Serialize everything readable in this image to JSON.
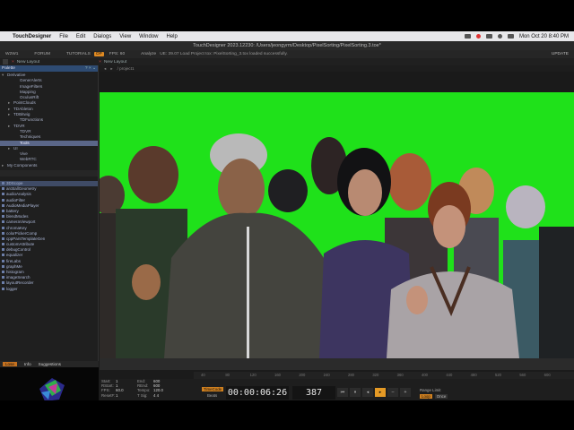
{
  "menubar": {
    "app_name": "TouchDesigner",
    "items": [
      "File",
      "Edit",
      "Dialogs",
      "View",
      "Window",
      "Help"
    ],
    "clock": "Mon Oct 20  8:40 PM"
  },
  "window": {
    "title": "TouchDesigner 2023.12230: /Users/jeongyrm/Desktop/PixelSorting/PixelSorting.3.toe*"
  },
  "toolbar": {
    "w1": "W2W1",
    "forum": "FORUM",
    "tutorials": "TUTORIALS",
    "op_badge": "OP",
    "fps": "FPS: 60",
    "analyze": "Analyze",
    "status": "UE: 39.07  Load Project   tox: PixelSorting_3.tox loaded successfully.",
    "update": "UPDATE"
  },
  "pane_tabs": {
    "left": "New Layout",
    "right": "New Layout"
  },
  "palette": {
    "header": "Palette",
    "tree": [
      {
        "label": "Derivative",
        "depth": 0,
        "tri": "▾"
      },
      {
        "label": "GenerAlerts",
        "depth": 2,
        "tri": ""
      },
      {
        "label": "ImageFilters",
        "depth": 2,
        "tri": ""
      },
      {
        "label": "Mapping",
        "depth": 2,
        "tri": ""
      },
      {
        "label": "OculusRift",
        "depth": 2,
        "tri": ""
      },
      {
        "label": "PointClouds",
        "depth": 1,
        "tri": "▸"
      },
      {
        "label": "TDAbleton",
        "depth": 1,
        "tri": "▸"
      },
      {
        "label": "TDBitwig",
        "depth": 1,
        "tri": "▸"
      },
      {
        "label": "TDFunctions",
        "depth": 2,
        "tri": ""
      },
      {
        "label": "TDVR",
        "depth": 1,
        "tri": "▸"
      },
      {
        "label": "TDVR",
        "depth": 2,
        "tri": ""
      },
      {
        "label": "Techniques",
        "depth": 2,
        "tri": ""
      },
      {
        "label": "Tools",
        "depth": 2,
        "tri": "",
        "selected": true
      },
      {
        "label": "UI",
        "depth": 1,
        "tri": "▸"
      },
      {
        "label": "Vive",
        "depth": 2,
        "tri": ""
      },
      {
        "label": "WebRTC",
        "depth": 2,
        "tri": ""
      },
      {
        "label": "My Components",
        "depth": 0,
        "tri": "▸"
      }
    ],
    "list": [
      {
        "label": "3DScope",
        "selected": true
      },
      {
        "label": "arcBallGeometry"
      },
      {
        "label": "audioAnalysis"
      },
      {
        "label": "audioFilter"
      },
      {
        "label": "AudioMediaPlayer"
      },
      {
        "label": "battery"
      },
      {
        "label": "blendModes"
      },
      {
        "label": "cameraViewport"
      },
      {
        "label": "chromaKey"
      },
      {
        "label": "colorPickerComp"
      },
      {
        "label": "cppParsTemplateGen"
      },
      {
        "label": "customAttribute"
      },
      {
        "label": "debugControl"
      },
      {
        "label": "equalizer"
      },
      {
        "label": "fireLabs"
      },
      {
        "label": "graphMe"
      },
      {
        "label": "histogram"
      },
      {
        "label": "imageSearch"
      },
      {
        "label": "layoutRecorder"
      },
      {
        "label": "logger"
      }
    ]
  },
  "info_tabs": {
    "active": "Lose",
    "tab2": "Info",
    "tab3": "Suggestions"
  },
  "network": {
    "path": "/ project1"
  },
  "timeline": {
    "ticks": [
      "40",
      "80",
      "120",
      "160",
      "200",
      "240",
      "280",
      "320",
      "360",
      "400",
      "440",
      "480",
      "520",
      "560",
      "600"
    ]
  },
  "stats": {
    "start_k": "Start:",
    "start_v": "1",
    "end_k": "End:",
    "end_v": "600",
    "rstart_k": "RStart:",
    "rstart_v": "1",
    "rend_k": "REnd:",
    "rend_v": "600",
    "fps_k": "FPS:",
    "fps_v": "60.0",
    "tempo_k": "Tempo:",
    "tempo_v": "120.0",
    "reset_k": "ResetF:",
    "reset_v": "1",
    "tsig_k": "T Sig:",
    "tsig_v": "4   4"
  },
  "playbar": {
    "timecode_label": "TimeCode",
    "beats_label": "Beats",
    "timecode": "00:00:06:26",
    "frame": "387",
    "range_limit": "Range Limit",
    "loop": "Loop",
    "once": "Once"
  },
  "colors": {
    "accent": "#e59a25",
    "viewer_bg": "#1fe11a",
    "selection": "#5a6688"
  }
}
